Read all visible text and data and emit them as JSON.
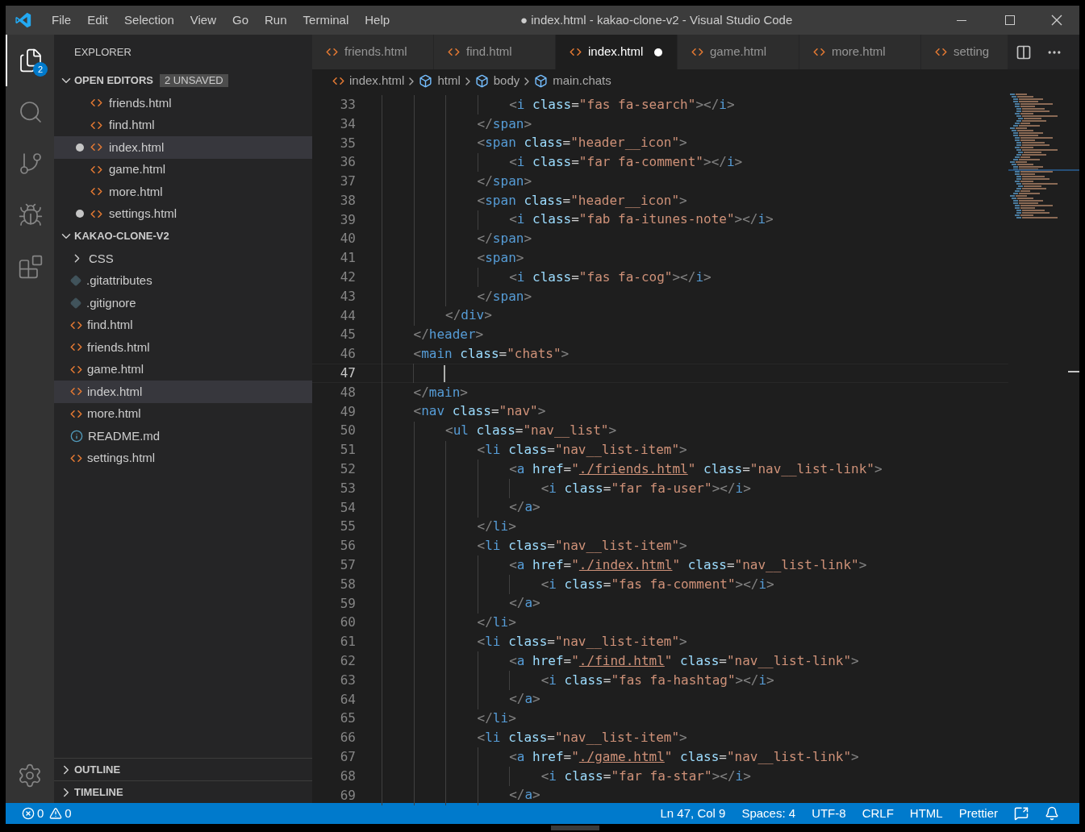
{
  "window": {
    "title": "● index.html - kakao-clone-v2 - Visual Studio Code"
  },
  "menu": [
    "File",
    "Edit",
    "Selection",
    "View",
    "Go",
    "Run",
    "Terminal",
    "Help"
  ],
  "activity_bar": [
    {
      "kind": "files",
      "selected": true,
      "badge": "2"
    },
    {
      "kind": "search",
      "selected": false
    },
    {
      "kind": "git",
      "selected": false
    },
    {
      "kind": "debug",
      "selected": false
    },
    {
      "kind": "extensions",
      "selected": false
    }
  ],
  "sidebar": {
    "title": "EXPLORER",
    "open_editors": {
      "title": "OPEN EDITORS",
      "badge": "2 UNSAVED",
      "expanded": true,
      "items": [
        {
          "label": "friends.html",
          "dirty": false,
          "selected": false
        },
        {
          "label": "find.html",
          "dirty": false,
          "selected": false
        },
        {
          "label": "index.html",
          "dirty": true,
          "selected": true
        },
        {
          "label": "game.html",
          "dirty": false,
          "selected": false
        },
        {
          "label": "more.html",
          "dirty": false,
          "selected": false
        },
        {
          "label": "settings.html",
          "dirty": true,
          "selected": false
        }
      ]
    },
    "folder": {
      "title": "KAKAO-CLONE-V2",
      "expanded": true,
      "items": [
        {
          "label": "CSS",
          "kind": "folder",
          "expanded": false,
          "selected": false
        },
        {
          "label": ".gitattributes",
          "kind": "git",
          "selected": false
        },
        {
          "label": ".gitignore",
          "kind": "git",
          "selected": false
        },
        {
          "label": "find.html",
          "kind": "html",
          "selected": false
        },
        {
          "label": "friends.html",
          "kind": "html",
          "selected": false
        },
        {
          "label": "game.html",
          "kind": "html",
          "selected": false
        },
        {
          "label": "index.html",
          "kind": "html",
          "selected": true
        },
        {
          "label": "more.html",
          "kind": "html",
          "selected": false
        },
        {
          "label": "README.md",
          "kind": "info",
          "selected": false
        },
        {
          "label": "settings.html",
          "kind": "html",
          "selected": false
        }
      ]
    },
    "outline": {
      "title": "OUTLINE",
      "expanded": false
    },
    "timeline": {
      "title": "TIMELINE",
      "expanded": false
    }
  },
  "tabs": [
    {
      "label": "friends.html",
      "selected": false,
      "dirty": false
    },
    {
      "label": "find.html",
      "selected": false,
      "dirty": false
    },
    {
      "label": "index.html",
      "selected": true,
      "dirty": true
    },
    {
      "label": "game.html",
      "selected": false,
      "dirty": false
    },
    {
      "label": "more.html",
      "selected": false,
      "dirty": false
    },
    {
      "label": "setting",
      "selected": false,
      "dirty": false
    }
  ],
  "breadcrumbs": [
    {
      "label": "index.html",
      "kind": "file"
    },
    {
      "label": "html",
      "kind": "element"
    },
    {
      "label": "body",
      "kind": "element"
    },
    {
      "label": "main.chats",
      "kind": "element"
    }
  ],
  "code_lines": [
    {
      "number": "33",
      "text": "                <i class=\"fas fa-search\"></i>",
      "current": false
    },
    {
      "number": "34",
      "text": "            </span>",
      "current": false
    },
    {
      "number": "35",
      "text": "            <span class=\"header__icon\">",
      "current": false
    },
    {
      "number": "36",
      "text": "                <i class=\"far fa-comment\"></i>",
      "current": false
    },
    {
      "number": "37",
      "text": "            </span>",
      "current": false
    },
    {
      "number": "38",
      "text": "            <span class=\"header__icon\">",
      "current": false
    },
    {
      "number": "39",
      "text": "                <i class=\"fab fa-itunes-note\"></i>",
      "current": false
    },
    {
      "number": "40",
      "text": "            </span>",
      "current": false
    },
    {
      "number": "41",
      "text": "            <span>",
      "current": false
    },
    {
      "number": "42",
      "text": "                <i class=\"fas fa-cog\"></i>",
      "current": false
    },
    {
      "number": "43",
      "text": "            </span>",
      "current": false
    },
    {
      "number": "44",
      "text": "        </div>",
      "current": false
    },
    {
      "number": "45",
      "text": "    </header>",
      "current": false
    },
    {
      "number": "46",
      "text": "    <main class=\"chats\">",
      "current": false
    },
    {
      "number": "47",
      "current": true
    },
    {
      "number": "48",
      "text": "    </main>",
      "current": false
    },
    {
      "number": "49",
      "text": "    <nav class=\"nav\">",
      "current": false
    },
    {
      "number": "50",
      "text": "        <ul class=\"nav__list\">",
      "current": false
    },
    {
      "number": "51",
      "text": "            <li class=\"nav__list-item\">",
      "current": false
    },
    {
      "number": "52",
      "text": "                <a href=\"./friends.html\" class=\"nav__list-link\">",
      "current": false
    },
    {
      "number": "53",
      "text": "                    <i class=\"far fa-user\"></i>",
      "current": false
    },
    {
      "number": "54",
      "text": "                </a>",
      "current": false
    },
    {
      "number": "55",
      "text": "            </li>",
      "current": false
    },
    {
      "number": "56",
      "text": "            <li class=\"nav__list-item\">",
      "current": false
    },
    {
      "number": "57",
      "text": "                <a href=\"./index.html\" class=\"nav__list-link\">",
      "current": false
    },
    {
      "number": "58",
      "text": "                    <i class=\"fas fa-comment\"></i>",
      "current": false
    },
    {
      "number": "59",
      "text": "                </a>",
      "current": false
    },
    {
      "number": "60",
      "text": "            </li>",
      "current": false
    },
    {
      "number": "61",
      "text": "            <li class=\"nav__list-item\">",
      "current": false
    },
    {
      "number": "62",
      "text": "                <a href=\"./find.html\" class=\"nav__list-link\">",
      "current": false
    },
    {
      "number": "63",
      "text": "                    <i class=\"fas fa-hashtag\"></i>",
      "current": false
    },
    {
      "number": "64",
      "text": "                </a>",
      "current": false
    },
    {
      "number": "65",
      "text": "            </li>",
      "current": false
    },
    {
      "number": "66",
      "text": "            <li class=\"nav__list-item\">",
      "current": false
    },
    {
      "number": "67",
      "text": "                <a href=\"./game.html\" class=\"nav__list-link\">",
      "current": false
    },
    {
      "number": "68",
      "text": "                    <i class=\"far fa-star\"></i>",
      "current": false
    },
    {
      "number": "69",
      "text": "                </a>",
      "current": false
    }
  ],
  "status_bar": {
    "errors": "0",
    "warnings": "0",
    "items": [
      "Ln 47, Col 9",
      "Spaces: 4",
      "UTF-8",
      "CRLF",
      "HTML",
      "Prettier"
    ]
  }
}
